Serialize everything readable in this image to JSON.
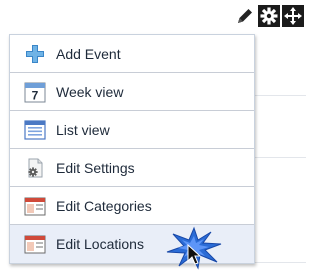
{
  "toolbar": {
    "buttons": [
      {
        "icon": "pencil-icon"
      },
      {
        "icon": "gear-icon"
      },
      {
        "icon": "move-icon"
      }
    ]
  },
  "menu": {
    "items": [
      {
        "label": "Add Event",
        "icon": "plus-icon"
      },
      {
        "label": "Week view",
        "icon": "calendar-7-icon"
      },
      {
        "label": "List view",
        "icon": "list-icon"
      },
      {
        "label": "Edit Settings",
        "icon": "settings-page-icon"
      },
      {
        "label": "Edit Categories",
        "icon": "window-icon"
      },
      {
        "label": "Edit Locations",
        "icon": "window-icon"
      }
    ]
  },
  "colors": {
    "menu_border": "#c9d2de",
    "hover_bg": "#e9eef8",
    "label_text": "#1e2a3a",
    "burst": "#2b6cd6"
  }
}
